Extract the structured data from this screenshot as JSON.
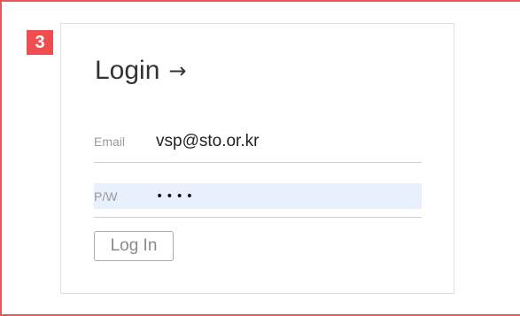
{
  "step_badge": "3",
  "login": {
    "title": "Login",
    "title_arrow_icon": "arrow-right-icon",
    "email_label": "Email",
    "email_value": "vsp@sto.or.kr",
    "password_label": "P/W",
    "password_value": "••••",
    "submit_label": "Log In"
  },
  "colors": {
    "frame_border": "#e8575a",
    "badge_bg": "#f04d4f",
    "password_autofill_bg": "#e8f0fe"
  }
}
